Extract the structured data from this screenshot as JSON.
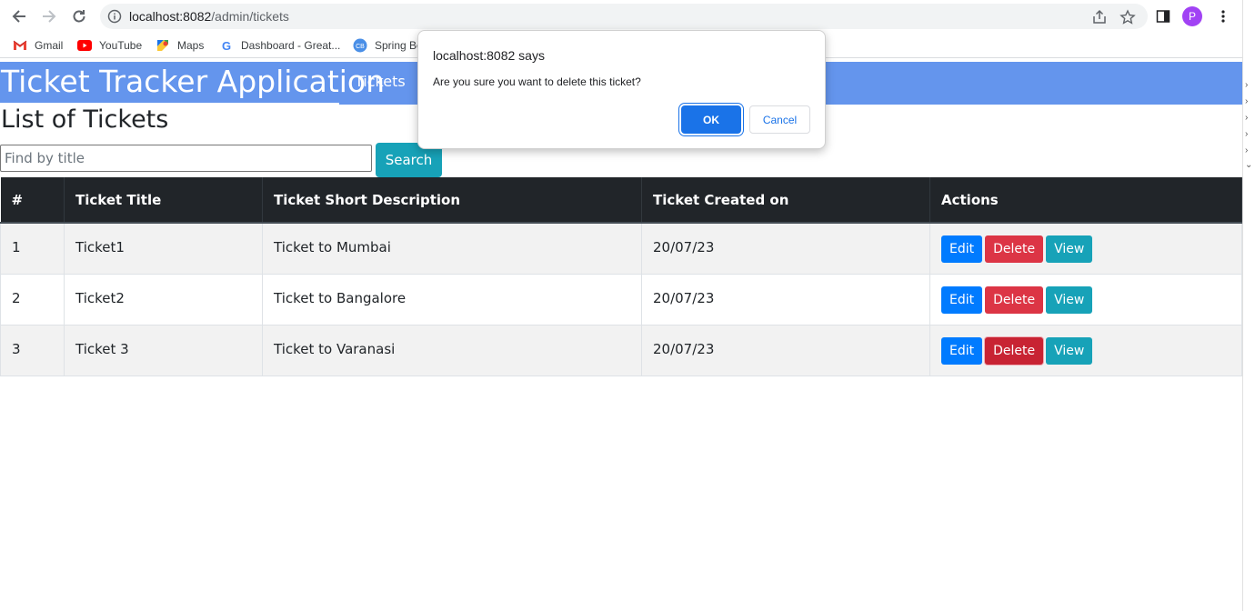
{
  "browser": {
    "url_host": "localhost:8082",
    "url_path": "/admin/tickets",
    "profile_initial": "P",
    "bookmarks": [
      {
        "label": "Gmail",
        "icon": "gmail-icon"
      },
      {
        "label": "YouTube",
        "icon": "youtube-icon"
      },
      {
        "label": "Maps",
        "icon": "maps-icon"
      },
      {
        "label": "Dashboard - Great...",
        "icon": "google-icon"
      },
      {
        "label": "Spring Bo",
        "icon": "cb-icon"
      }
    ]
  },
  "app": {
    "brand": "Ticket Tracker Application",
    "nav_link": "Tickets",
    "page_title": "List of Tickets",
    "search_placeholder": "Find by title",
    "search_button": "Search"
  },
  "table": {
    "headers": [
      "#",
      "Ticket Title",
      "Ticket Short Description",
      "Ticket Created on",
      "Actions"
    ],
    "rows": [
      {
        "num": "1",
        "title": "Ticket1",
        "desc": "Ticket to Mumbai",
        "created": "20/07/23"
      },
      {
        "num": "2",
        "title": "Ticket2",
        "desc": "Ticket to Bangalore",
        "created": "20/07/23"
      },
      {
        "num": "3",
        "title": "Ticket 3",
        "desc": "Ticket to Varanasi",
        "created": "20/07/23"
      }
    ],
    "actions": {
      "edit": "Edit",
      "delete": "Delete",
      "view": "View"
    }
  },
  "dialog": {
    "title": "localhost:8082 says",
    "message": "Are you sure you want to delete this ticket?",
    "ok": "OK",
    "cancel": "Cancel"
  },
  "colors": {
    "header_bg": "#6495ed",
    "table_head_bg": "#212529",
    "edit": "#007bff",
    "delete": "#dc3545",
    "view": "#17a2b8",
    "dialog_ok": "#1a73e8"
  }
}
